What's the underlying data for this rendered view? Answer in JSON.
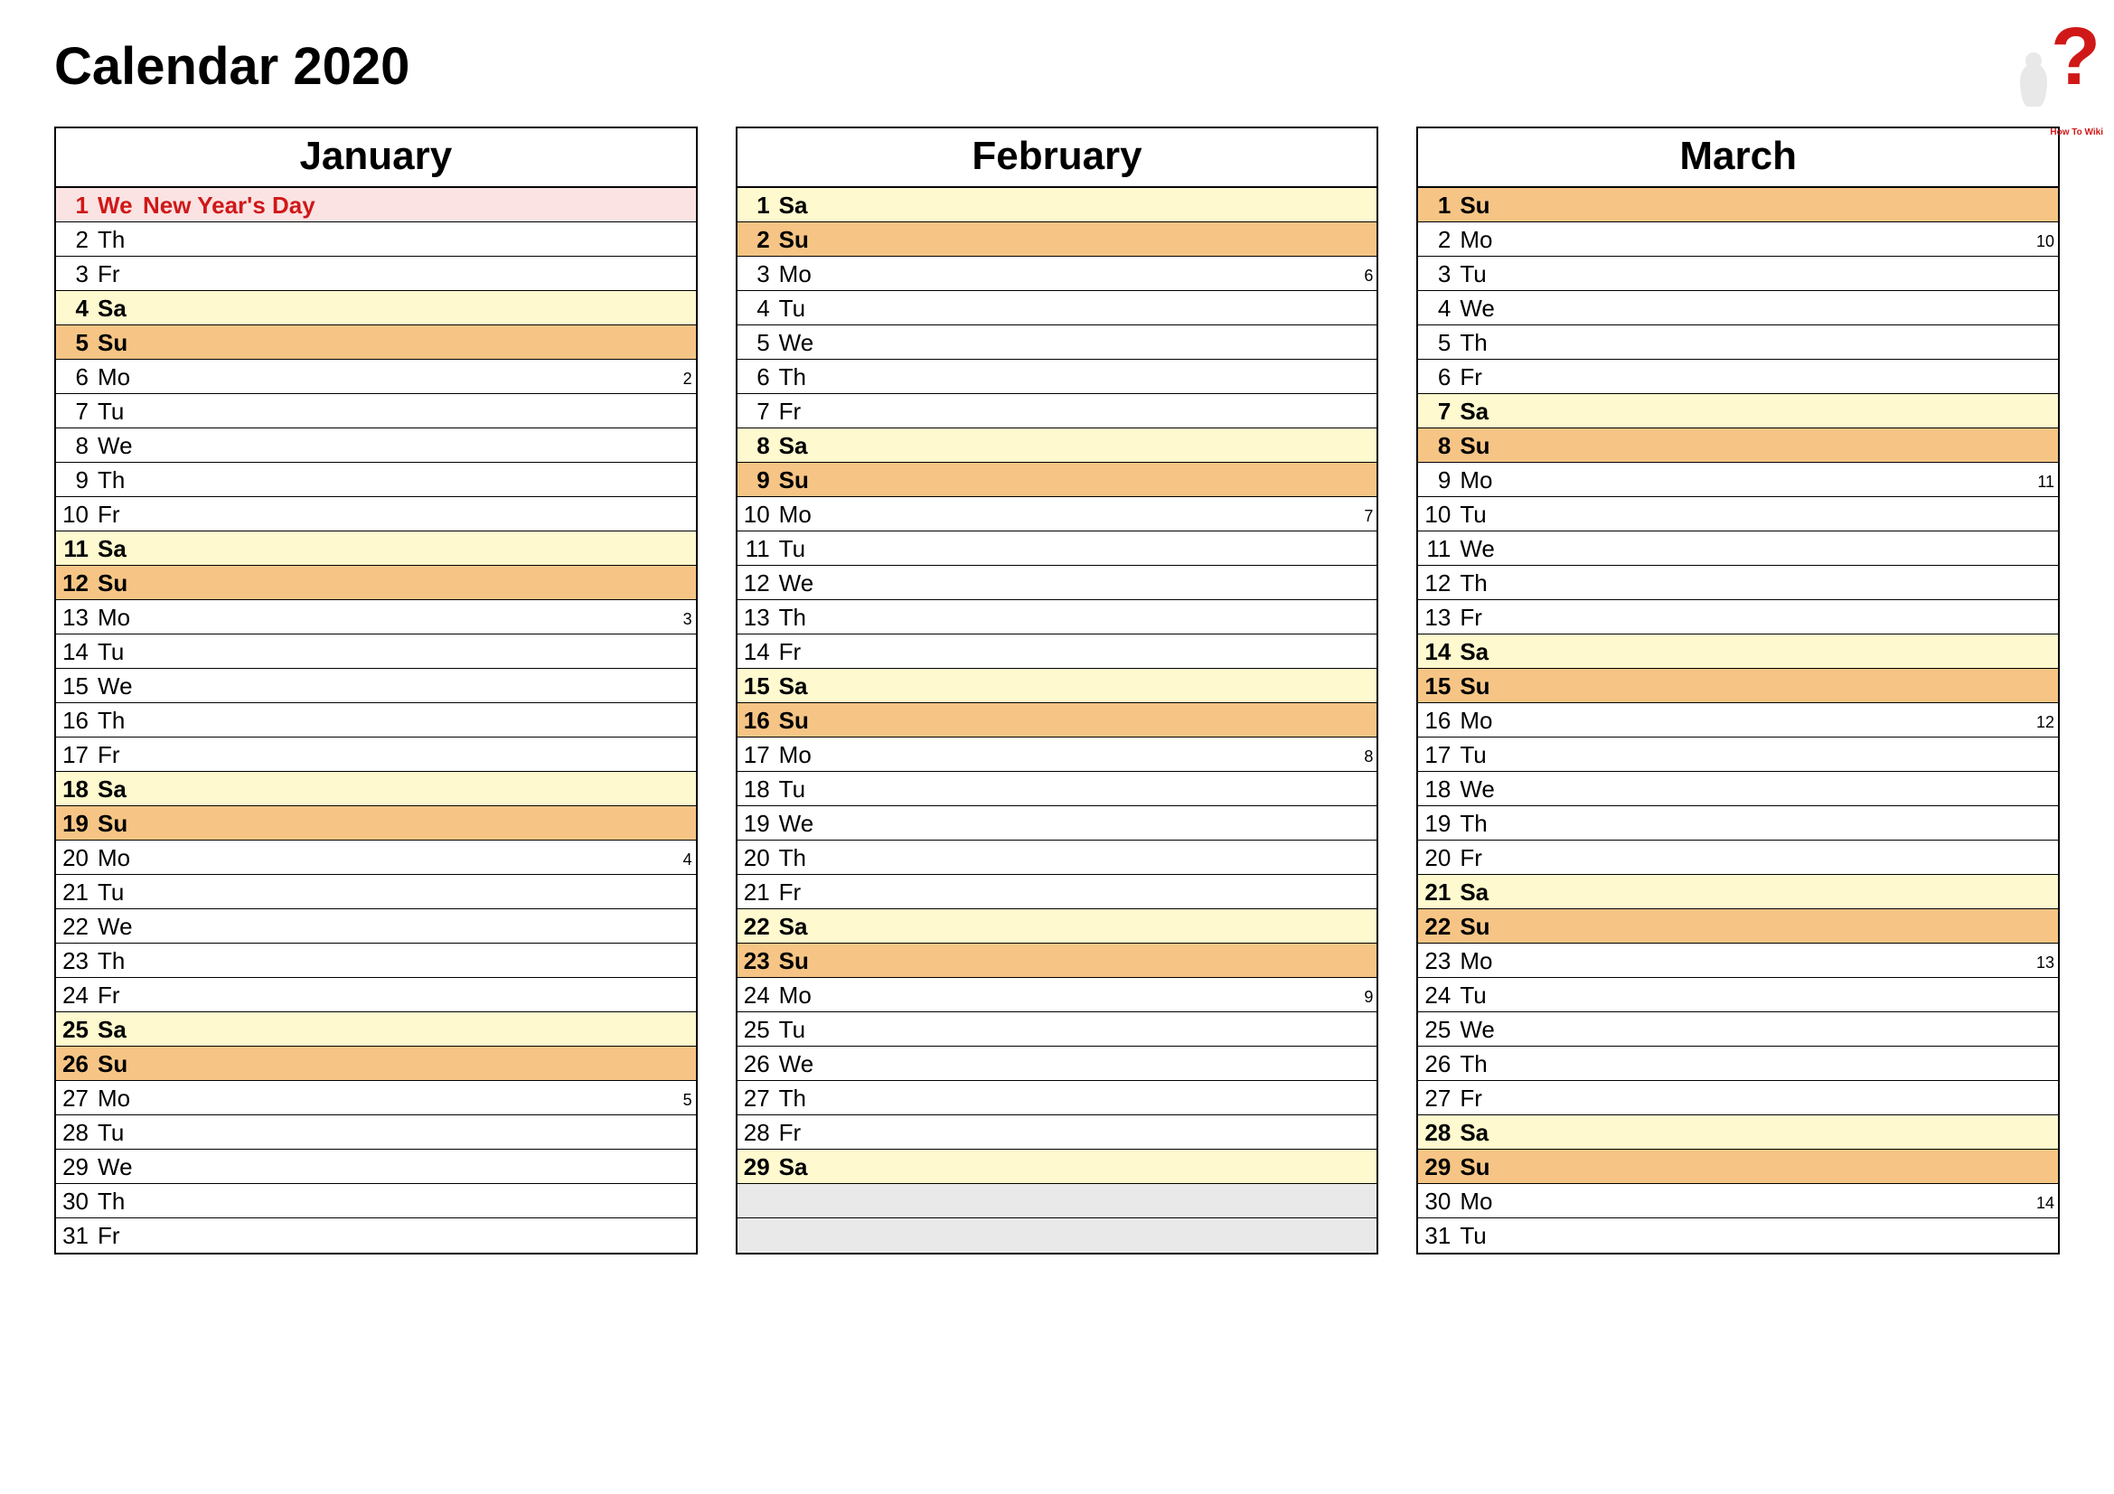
{
  "title": "Calendar 2020",
  "logo_text": "How To Wiki",
  "months": [
    {
      "name": "January",
      "days": [
        {
          "num": "1",
          "abbr": "We",
          "event": "New Year's Day",
          "week": "",
          "style": "holiday"
        },
        {
          "num": "2",
          "abbr": "Th",
          "event": "",
          "week": "",
          "style": ""
        },
        {
          "num": "3",
          "abbr": "Fr",
          "event": "",
          "week": "",
          "style": ""
        },
        {
          "num": "4",
          "abbr": "Sa",
          "event": "",
          "week": "",
          "style": "sa"
        },
        {
          "num": "5",
          "abbr": "Su",
          "event": "",
          "week": "",
          "style": "su"
        },
        {
          "num": "6",
          "abbr": "Mo",
          "event": "",
          "week": "2",
          "style": ""
        },
        {
          "num": "7",
          "abbr": "Tu",
          "event": "",
          "week": "",
          "style": ""
        },
        {
          "num": "8",
          "abbr": "We",
          "event": "",
          "week": "",
          "style": ""
        },
        {
          "num": "9",
          "abbr": "Th",
          "event": "",
          "week": "",
          "style": ""
        },
        {
          "num": "10",
          "abbr": "Fr",
          "event": "",
          "week": "",
          "style": ""
        },
        {
          "num": "11",
          "abbr": "Sa",
          "event": "",
          "week": "",
          "style": "sa"
        },
        {
          "num": "12",
          "abbr": "Su",
          "event": "",
          "week": "",
          "style": "su"
        },
        {
          "num": "13",
          "abbr": "Mo",
          "event": "",
          "week": "3",
          "style": ""
        },
        {
          "num": "14",
          "abbr": "Tu",
          "event": "",
          "week": "",
          "style": ""
        },
        {
          "num": "15",
          "abbr": "We",
          "event": "",
          "week": "",
          "style": ""
        },
        {
          "num": "16",
          "abbr": "Th",
          "event": "",
          "week": "",
          "style": ""
        },
        {
          "num": "17",
          "abbr": "Fr",
          "event": "",
          "week": "",
          "style": ""
        },
        {
          "num": "18",
          "abbr": "Sa",
          "event": "",
          "week": "",
          "style": "sa"
        },
        {
          "num": "19",
          "abbr": "Su",
          "event": "",
          "week": "",
          "style": "su"
        },
        {
          "num": "20",
          "abbr": "Mo",
          "event": "",
          "week": "4",
          "style": ""
        },
        {
          "num": "21",
          "abbr": "Tu",
          "event": "",
          "week": "",
          "style": ""
        },
        {
          "num": "22",
          "abbr": "We",
          "event": "",
          "week": "",
          "style": ""
        },
        {
          "num": "23",
          "abbr": "Th",
          "event": "",
          "week": "",
          "style": ""
        },
        {
          "num": "24",
          "abbr": "Fr",
          "event": "",
          "week": "",
          "style": ""
        },
        {
          "num": "25",
          "abbr": "Sa",
          "event": "",
          "week": "",
          "style": "sa"
        },
        {
          "num": "26",
          "abbr": "Su",
          "event": "",
          "week": "",
          "style": "su"
        },
        {
          "num": "27",
          "abbr": "Mo",
          "event": "",
          "week": "5",
          "style": ""
        },
        {
          "num": "28",
          "abbr": "Tu",
          "event": "",
          "week": "",
          "style": ""
        },
        {
          "num": "29",
          "abbr": "We",
          "event": "",
          "week": "",
          "style": ""
        },
        {
          "num": "30",
          "abbr": "Th",
          "event": "",
          "week": "",
          "style": ""
        },
        {
          "num": "31",
          "abbr": "Fr",
          "event": "",
          "week": "",
          "style": ""
        }
      ]
    },
    {
      "name": "February",
      "days": [
        {
          "num": "1",
          "abbr": "Sa",
          "event": "",
          "week": "",
          "style": "sa"
        },
        {
          "num": "2",
          "abbr": "Su",
          "event": "",
          "week": "",
          "style": "su"
        },
        {
          "num": "3",
          "abbr": "Mo",
          "event": "",
          "week": "6",
          "style": ""
        },
        {
          "num": "4",
          "abbr": "Tu",
          "event": "",
          "week": "",
          "style": ""
        },
        {
          "num": "5",
          "abbr": "We",
          "event": "",
          "week": "",
          "style": ""
        },
        {
          "num": "6",
          "abbr": "Th",
          "event": "",
          "week": "",
          "style": ""
        },
        {
          "num": "7",
          "abbr": "Fr",
          "event": "",
          "week": "",
          "style": ""
        },
        {
          "num": "8",
          "abbr": "Sa",
          "event": "",
          "week": "",
          "style": "sa"
        },
        {
          "num": "9",
          "abbr": "Su",
          "event": "",
          "week": "",
          "style": "su"
        },
        {
          "num": "10",
          "abbr": "Mo",
          "event": "",
          "week": "7",
          "style": ""
        },
        {
          "num": "11",
          "abbr": "Tu",
          "event": "",
          "week": "",
          "style": ""
        },
        {
          "num": "12",
          "abbr": "We",
          "event": "",
          "week": "",
          "style": ""
        },
        {
          "num": "13",
          "abbr": "Th",
          "event": "",
          "week": "",
          "style": ""
        },
        {
          "num": "14",
          "abbr": "Fr",
          "event": "",
          "week": "",
          "style": ""
        },
        {
          "num": "15",
          "abbr": "Sa",
          "event": "",
          "week": "",
          "style": "sa"
        },
        {
          "num": "16",
          "abbr": "Su",
          "event": "",
          "week": "",
          "style": "su"
        },
        {
          "num": "17",
          "abbr": "Mo",
          "event": "",
          "week": "8",
          "style": ""
        },
        {
          "num": "18",
          "abbr": "Tu",
          "event": "",
          "week": "",
          "style": ""
        },
        {
          "num": "19",
          "abbr": "We",
          "event": "",
          "week": "",
          "style": ""
        },
        {
          "num": "20",
          "abbr": "Th",
          "event": "",
          "week": "",
          "style": ""
        },
        {
          "num": "21",
          "abbr": "Fr",
          "event": "",
          "week": "",
          "style": ""
        },
        {
          "num": "22",
          "abbr": "Sa",
          "event": "",
          "week": "",
          "style": "sa"
        },
        {
          "num": "23",
          "abbr": "Su",
          "event": "",
          "week": "",
          "style": "su"
        },
        {
          "num": "24",
          "abbr": "Mo",
          "event": "",
          "week": "9",
          "style": ""
        },
        {
          "num": "25",
          "abbr": "Tu",
          "event": "",
          "week": "",
          "style": ""
        },
        {
          "num": "26",
          "abbr": "We",
          "event": "",
          "week": "",
          "style": ""
        },
        {
          "num": "27",
          "abbr": "Th",
          "event": "",
          "week": "",
          "style": ""
        },
        {
          "num": "28",
          "abbr": "Fr",
          "event": "",
          "week": "",
          "style": ""
        },
        {
          "num": "29",
          "abbr": "Sa",
          "event": "",
          "week": "",
          "style": "sa"
        },
        {
          "num": "",
          "abbr": "",
          "event": "",
          "week": "",
          "style": "empty"
        },
        {
          "num": "",
          "abbr": "",
          "event": "",
          "week": "",
          "style": "empty"
        }
      ]
    },
    {
      "name": "March",
      "days": [
        {
          "num": "1",
          "abbr": "Su",
          "event": "",
          "week": "",
          "style": "su"
        },
        {
          "num": "2",
          "abbr": "Mo",
          "event": "",
          "week": "10",
          "style": ""
        },
        {
          "num": "3",
          "abbr": "Tu",
          "event": "",
          "week": "",
          "style": ""
        },
        {
          "num": "4",
          "abbr": "We",
          "event": "",
          "week": "",
          "style": ""
        },
        {
          "num": "5",
          "abbr": "Th",
          "event": "",
          "week": "",
          "style": ""
        },
        {
          "num": "6",
          "abbr": "Fr",
          "event": "",
          "week": "",
          "style": ""
        },
        {
          "num": "7",
          "abbr": "Sa",
          "event": "",
          "week": "",
          "style": "sa"
        },
        {
          "num": "8",
          "abbr": "Su",
          "event": "",
          "week": "",
          "style": "su"
        },
        {
          "num": "9",
          "abbr": "Mo",
          "event": "",
          "week": "11",
          "style": ""
        },
        {
          "num": "10",
          "abbr": "Tu",
          "event": "",
          "week": "",
          "style": ""
        },
        {
          "num": "11",
          "abbr": "We",
          "event": "",
          "week": "",
          "style": ""
        },
        {
          "num": "12",
          "abbr": "Th",
          "event": "",
          "week": "",
          "style": ""
        },
        {
          "num": "13",
          "abbr": "Fr",
          "event": "",
          "week": "",
          "style": ""
        },
        {
          "num": "14",
          "abbr": "Sa",
          "event": "",
          "week": "",
          "style": "sa"
        },
        {
          "num": "15",
          "abbr": "Su",
          "event": "",
          "week": "",
          "style": "su"
        },
        {
          "num": "16",
          "abbr": "Mo",
          "event": "",
          "week": "12",
          "style": ""
        },
        {
          "num": "17",
          "abbr": "Tu",
          "event": "",
          "week": "",
          "style": ""
        },
        {
          "num": "18",
          "abbr": "We",
          "event": "",
          "week": "",
          "style": ""
        },
        {
          "num": "19",
          "abbr": "Th",
          "event": "",
          "week": "",
          "style": ""
        },
        {
          "num": "20",
          "abbr": "Fr",
          "event": "",
          "week": "",
          "style": ""
        },
        {
          "num": "21",
          "abbr": "Sa",
          "event": "",
          "week": "",
          "style": "sa"
        },
        {
          "num": "22",
          "abbr": "Su",
          "event": "",
          "week": "",
          "style": "su"
        },
        {
          "num": "23",
          "abbr": "Mo",
          "event": "",
          "week": "13",
          "style": ""
        },
        {
          "num": "24",
          "abbr": "Tu",
          "event": "",
          "week": "",
          "style": ""
        },
        {
          "num": "25",
          "abbr": "We",
          "event": "",
          "week": "",
          "style": ""
        },
        {
          "num": "26",
          "abbr": "Th",
          "event": "",
          "week": "",
          "style": ""
        },
        {
          "num": "27",
          "abbr": "Fr",
          "event": "",
          "week": "",
          "style": ""
        },
        {
          "num": "28",
          "abbr": "Sa",
          "event": "",
          "week": "",
          "style": "sa"
        },
        {
          "num": "29",
          "abbr": "Su",
          "event": "",
          "week": "",
          "style": "su"
        },
        {
          "num": "30",
          "abbr": "Mo",
          "event": "",
          "week": "14",
          "style": ""
        },
        {
          "num": "31",
          "abbr": "Tu",
          "event": "",
          "week": "",
          "style": ""
        }
      ]
    }
  ]
}
